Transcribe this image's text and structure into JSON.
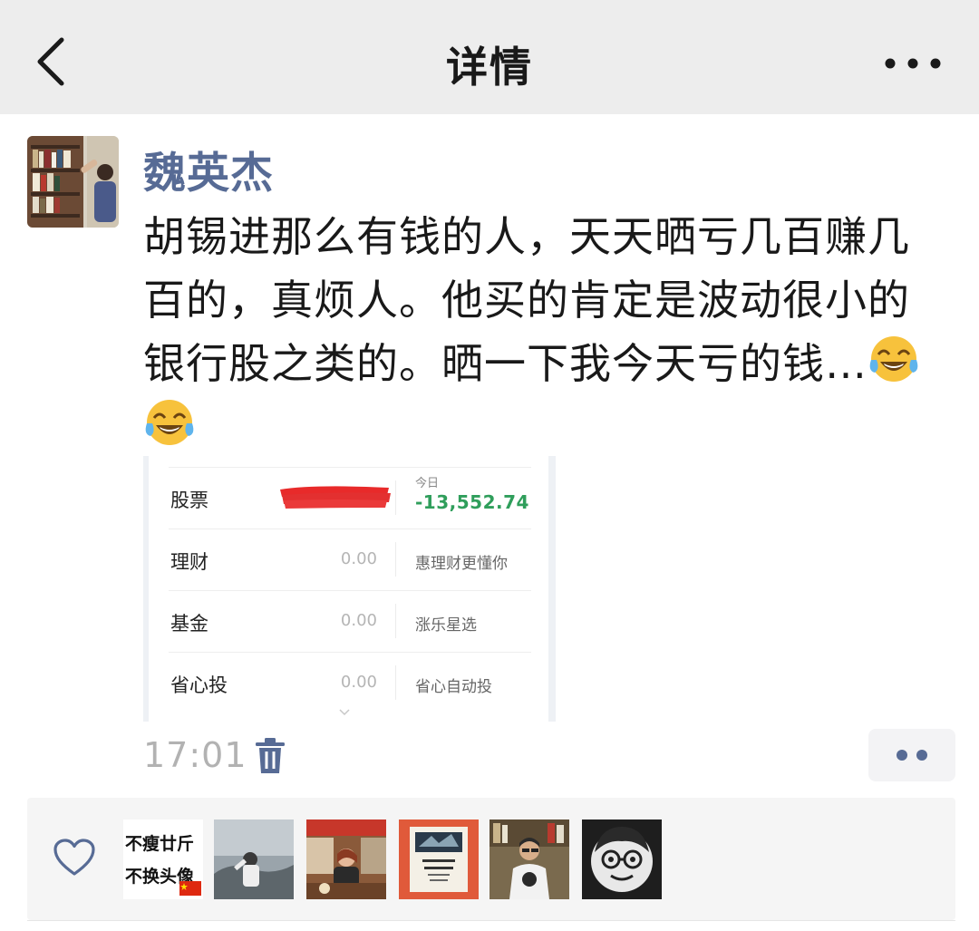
{
  "nav": {
    "title": "详情"
  },
  "post": {
    "author": "魏英杰",
    "text": "胡锡进那么有钱的人，天天晒亏几百赚几百的，真烦人。他买的肯定是波动很小的银行股之类的。晒一下我今天亏的钱…",
    "time": "17:01"
  },
  "screenshot": {
    "rows": [
      {
        "label": "股票",
        "value": "",
        "desc": ""
      },
      {
        "label": "理财",
        "value": "0.00",
        "desc": "惠理财更懂你"
      },
      {
        "label": "基金",
        "value": "0.00",
        "desc": "涨乐星选"
      },
      {
        "label": "省心投",
        "value": "0.00",
        "desc": "省心自动投"
      }
    ],
    "today_label": "今日",
    "today_value": "-13,552.74",
    "today_color": "#2f9e5b"
  },
  "likes": {
    "avatar1_text_line1": "不瘦廿斤",
    "avatar1_text_line2": "不换头像"
  },
  "colors": {
    "name_link": "#576b95",
    "nav_bg": "#ededed",
    "likes_bg": "#f5f5f5"
  }
}
